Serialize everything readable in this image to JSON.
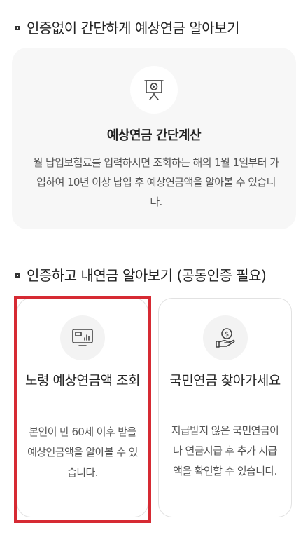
{
  "sections": {
    "simple": {
      "title": "인증없이 간단하게 예상연금 알아보기",
      "card": {
        "icon": "presentation-play-icon",
        "title": "예상연금 간단계산",
        "description": "월 납입보험료를 입력하시면 조회하는 해의 1월 1일부터 가입하여 10년 이상 납입 후 예상연금액을 알아볼 수 있습니다."
      }
    },
    "certified": {
      "title": "인증하고 내연금 알아보기 (공동인증 필요)",
      "cards": [
        {
          "icon": "monitor-chart-icon",
          "title": "노령 예상연금액 조회",
          "description": "본인이 만 60세 이후 받을 예상연금액을 알아볼 수 있습니다.",
          "selected": true
        },
        {
          "icon": "hand-coin-icon",
          "title": "국민연금 찾아가세요",
          "description": "지급받지 않은 국민연금이나 연금지급 후 추가 지급액을 확인할 수 있습니다."
        }
      ]
    }
  },
  "colors": {
    "highlight_border": "#d62a33",
    "card_background": "#f7f7f7",
    "icon_stroke": "#444444"
  }
}
